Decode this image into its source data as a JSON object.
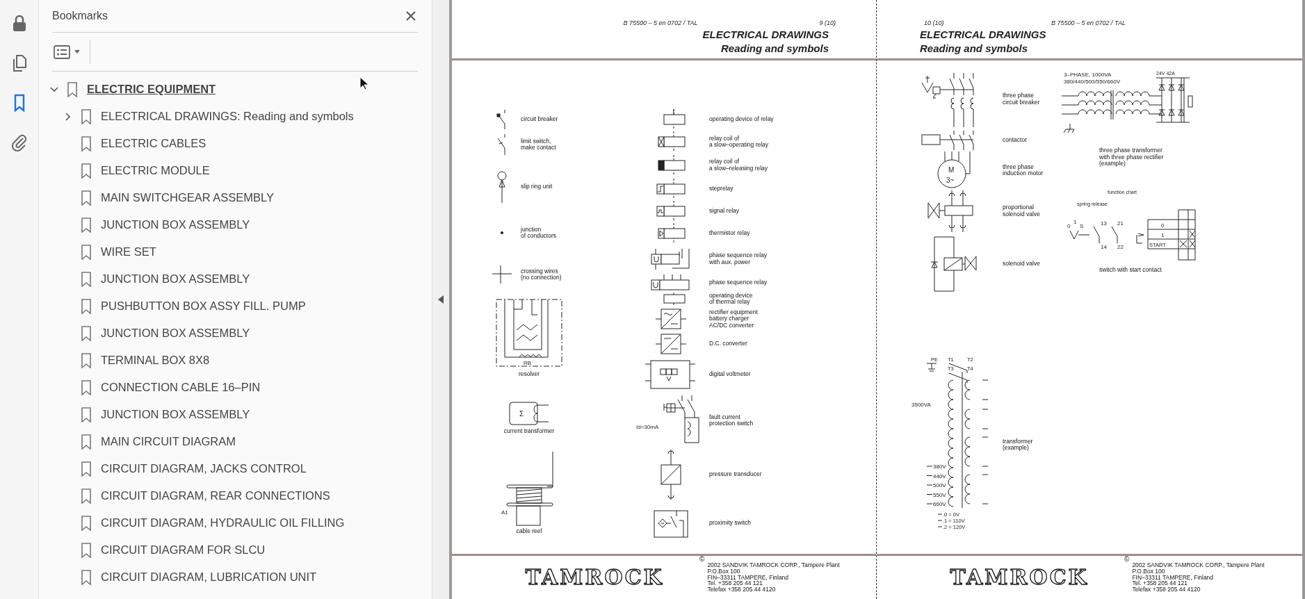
{
  "toolbar": {
    "tools": [
      {
        "kind": "lock",
        "selected": false
      },
      {
        "kind": "pages",
        "selected": false
      },
      {
        "kind": "bookmark",
        "selected": true
      },
      {
        "kind": "attachment",
        "selected": false
      }
    ]
  },
  "bookmarks_panel": {
    "title": "Bookmarks",
    "items": [
      {
        "label": "ELECTRIC EQUIPMENT",
        "expanded": true,
        "selected": true,
        "children": [
          {
            "label": "ELECTRICAL DRAWINGS: Reading and symbols",
            "expanded": false,
            "selected": false
          },
          {
            "label": "ELECTRIC CABLES",
            "selected": false
          },
          {
            "label": "ELECTRIC MODULE",
            "selected": false
          },
          {
            "label": "MAIN SWITCHGEAR ASSEMBLY",
            "selected": false
          },
          {
            "label": "JUNCTION BOX ASSEMBLY",
            "selected": false
          },
          {
            "label": "WIRE SET",
            "selected": false
          },
          {
            "label": "JUNCTION BOX ASSEMBLY",
            "selected": false
          },
          {
            "label": "PUSHBUTTON BOX ASSY FILL. PUMP",
            "selected": false
          },
          {
            "label": "JUNCTION BOX ASSEMBLY",
            "selected": false
          },
          {
            "label": "TERMINAL BOX 8X8",
            "selected": false
          },
          {
            "label": "CONNECTION CABLE 16–PIN",
            "selected": false
          },
          {
            "label": "JUNCTION BOX ASSEMBLY",
            "selected": false
          },
          {
            "label": "MAIN CIRCUIT DIAGRAM",
            "selected": false
          },
          {
            "label": "CIRCUIT DIAGRAM, JACKS CONTROL",
            "selected": false
          },
          {
            "label": "CIRCUIT DIAGRAM, REAR CONNECTIONS",
            "selected": false
          },
          {
            "label": "CIRCUIT DIAGRAM, HYDRAULIC OIL FILLING",
            "selected": false
          },
          {
            "label": "CIRCUIT DIAGRAM FOR SLCU",
            "selected": false
          },
          {
            "label": "CIRCUIT DIAGRAM, LUBRICATION UNIT",
            "selected": false
          }
        ]
      }
    ]
  },
  "pages": [
    {
      "kind": "left",
      "doc_number": "B 75500 – 5 en 0702 / TAL",
      "page_number": "9 (10)",
      "title": "ELECTRICAL DRAWINGS",
      "subtitle": "Reading and symbols",
      "columns": [
        [
          {
            "kind": "circuit_breaker",
            "label": "circuit breaker"
          },
          {
            "kind": "limit_switch",
            "label": "limit switch,\nmake contact"
          },
          {
            "kind": "slip_ring",
            "label": "slip ring unit"
          },
          {
            "kind": "junction",
            "label": "junction\nof conductors"
          },
          {
            "kind": "crossing_wires",
            "label": "crossing wires\n(no connection)"
          },
          {
            "kind": "resolver",
            "label": "resolver",
            "texts": [
              "RB"
            ]
          },
          {
            "kind": "current_transformer",
            "label": "current transformer",
            "texts": [
              "Σ"
            ]
          },
          {
            "kind": "cable_reel",
            "label": "cable reel",
            "texts": [
              "A1"
            ]
          }
        ],
        [
          {
            "kind": "operating_device",
            "label": "operating device of relay"
          },
          {
            "kind": "slow_operating_relay",
            "label": "relay coil of\na slow–operating relay"
          },
          {
            "kind": "slow_releasing_relay",
            "label": "relay coil of\na slow–releasing relay"
          },
          {
            "kind": "step_relay",
            "label": "steprelay"
          },
          {
            "kind": "signal_relay",
            "label": "signal relay"
          },
          {
            "kind": "thermistor_relay",
            "label": "thermistor relay"
          },
          {
            "kind": "phase_sequence_aux",
            "label": "phase sequence relay\nwith aux. power"
          },
          {
            "kind": "phase_sequence",
            "label": "phase sequence relay"
          },
          {
            "kind": "thermal_relay",
            "label": "operating device\nof thermal relay"
          },
          {
            "kind": "rectifier",
            "label": "rectifier equipment\nbattery charger\nAC/DC converter"
          },
          {
            "kind": "dc_converter",
            "label": "D.C. converter"
          },
          {
            "kind": "voltmeter",
            "label": "digital voltmeter"
          },
          {
            "kind": "fault_current_switch",
            "label": "fault current\nprotection switch",
            "texts": [
              "Id=30mA"
            ]
          },
          {
            "kind": "pressure_transducer",
            "label": "pressure transducer"
          },
          {
            "kind": "proximity_switch",
            "label": "proximity switch"
          }
        ]
      ],
      "footer": {
        "logo": "TAMROCK",
        "copyright_mark": "©",
        "address_lines": [
          "2002  SANDVIK TAMROCK CORP., Tampere Plant",
          "P.O.Box 100",
          "FIN–33311 TAMPERE, Finland",
          "Tel. +358 205 44 121",
          "Telefax +358 205 44 4120"
        ]
      }
    },
    {
      "kind": "right",
      "doc_number": "B 75500 – 5 en 0702 / TAL",
      "page_number": "10 (10)",
      "title": "ELECTRICAL DRAWINGS",
      "subtitle": "Reading and symbols",
      "columns": [
        [
          {
            "kind": "three_phase_breaker",
            "label": "three phase\ncircuit breaker"
          },
          {
            "kind": "contactor",
            "label": "contactor"
          },
          {
            "kind": "induction_motor",
            "label": "three phase\ninduction motor",
            "texts": [
              "M",
              "3~"
            ]
          },
          {
            "kind": "proportional_valve",
            "label": "proportional\nsolenoid valve"
          },
          {
            "kind": "solenoid_valve",
            "label": "solenoid valve"
          },
          {
            "kind": "transformer",
            "label": "transformer\n(example)",
            "texts": [
              "PE",
              "T1",
              "T2",
              "T3",
              "T4",
              "3500VA",
              "380V",
              "440V",
              "500V",
              "550V",
              "660V",
              ".0 = 0V",
              ".1 = 110V",
              ".2 = 120V"
            ]
          }
        ],
        [
          {
            "kind": "rectifier_transformer",
            "label": "three phase transformer\nwith three phase rectifier\n(example)",
            "texts": [
              "3–PHASE, 1000VA",
              "380/440/500/550/660V",
              "24V 42A"
            ]
          },
          {
            "kind": "switch_chart",
            "label": "switch with start contact",
            "texts": [
              "function chart",
              "spring release",
              "0",
              "1",
              "S",
              "13",
              "21",
              "14",
              "22",
              "0",
              "1",
              "START"
            ]
          }
        ]
      ],
      "footer": {
        "logo": "TAMROCK",
        "copyright_mark": "©",
        "address_lines": [
          "2002  SANDVIK TAMROCK CORP., Tampere Plant",
          "P.O.Box 100",
          "FIN–33311 TAMPERE, Finland",
          "Tel. +358 205 44 121",
          "Telefax +358 205 44 4120"
        ]
      }
    }
  ]
}
